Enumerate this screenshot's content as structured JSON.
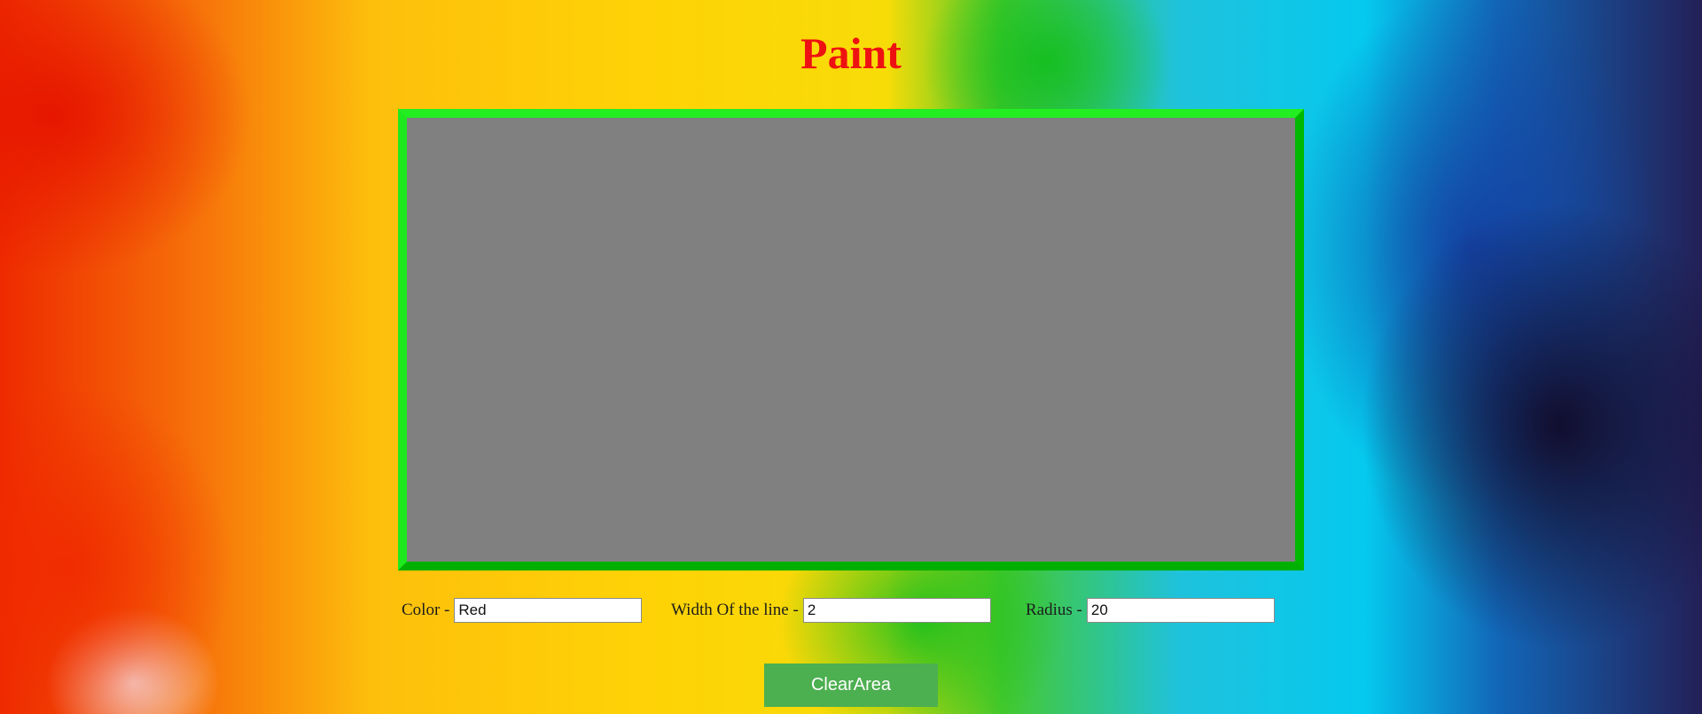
{
  "app": {
    "title": "Paint"
  },
  "colors": {
    "title": "#ee1111",
    "canvas_background": "#808080",
    "canvas_border": "#06d606",
    "button_background": "#4caf50",
    "button_text": "#ffffff"
  },
  "controls": {
    "color": {
      "label": "Color -",
      "value": "Red"
    },
    "line_width": {
      "label": "Width Of the line -",
      "value": "2"
    },
    "radius": {
      "label": "Radius -",
      "value": "20"
    }
  },
  "actions": {
    "clear_label": "ClearArea"
  }
}
